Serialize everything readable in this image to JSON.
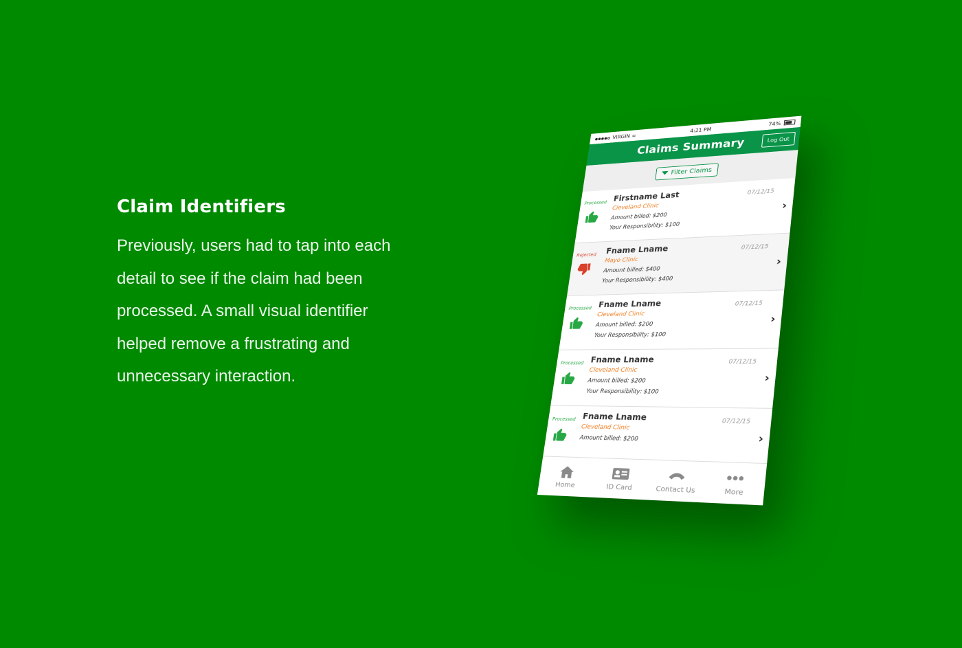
{
  "copy": {
    "heading": "Claim Identifiers",
    "body_lines": [
      "Previously, users had to tap into each",
      "detail to see if the claim had been",
      "processed. A small visual identifier",
      "helped remove a frustrating and",
      "unnecessary interaction."
    ]
  },
  "phone": {
    "status_bar": {
      "carrier": "VIRGIN",
      "time": "4:21 PM",
      "battery": "74%"
    },
    "header": {
      "title": "Claims Summary",
      "logout_label": "Log Out"
    },
    "filter_label": "Filter Claims",
    "claims": [
      {
        "status": "Processed",
        "name": "Firstname Last",
        "provider": "Cleveland Clinic",
        "billed": "Amount billed: $200",
        "responsibility": "Your Responsibility: $100",
        "date": "07/12/15"
      },
      {
        "status": "Rejected",
        "name": "Fname Lname",
        "provider": "Mayo Clinic",
        "billed": "Amount billed: $400",
        "responsibility": "Your Responsibility: $400",
        "date": "07/12/15"
      },
      {
        "status": "Processed",
        "name": "Fname Lname",
        "provider": "Cleveland Clinic",
        "billed": "Amount billed: $200",
        "responsibility": "Your Responsibility: $100",
        "date": "07/12/15"
      },
      {
        "status": "Processed",
        "name": "Fname Lname",
        "provider": "Cleveland Clinic",
        "billed": "Amount billed: $200",
        "responsibility": "Your Responsibility: $100",
        "date": "07/12/15"
      },
      {
        "status": "Processed",
        "name": "Fname Lname",
        "provider": "Cleveland Clinic",
        "billed": "Amount billed: $200",
        "responsibility": "",
        "date": "07/12/15"
      }
    ],
    "tabs": [
      {
        "label": "Home",
        "icon": "home-icon"
      },
      {
        "label": "ID Card",
        "icon": "id-card-icon"
      },
      {
        "label": "Contact Us",
        "icon": "phone-icon"
      },
      {
        "label": "More",
        "icon": "more-icon"
      }
    ]
  },
  "colors": {
    "background": "#008a00",
    "header_green": "#0a9448",
    "processed_green": "#27a844",
    "rejected_red": "#d9412a",
    "provider_orange": "#f07a1a"
  }
}
